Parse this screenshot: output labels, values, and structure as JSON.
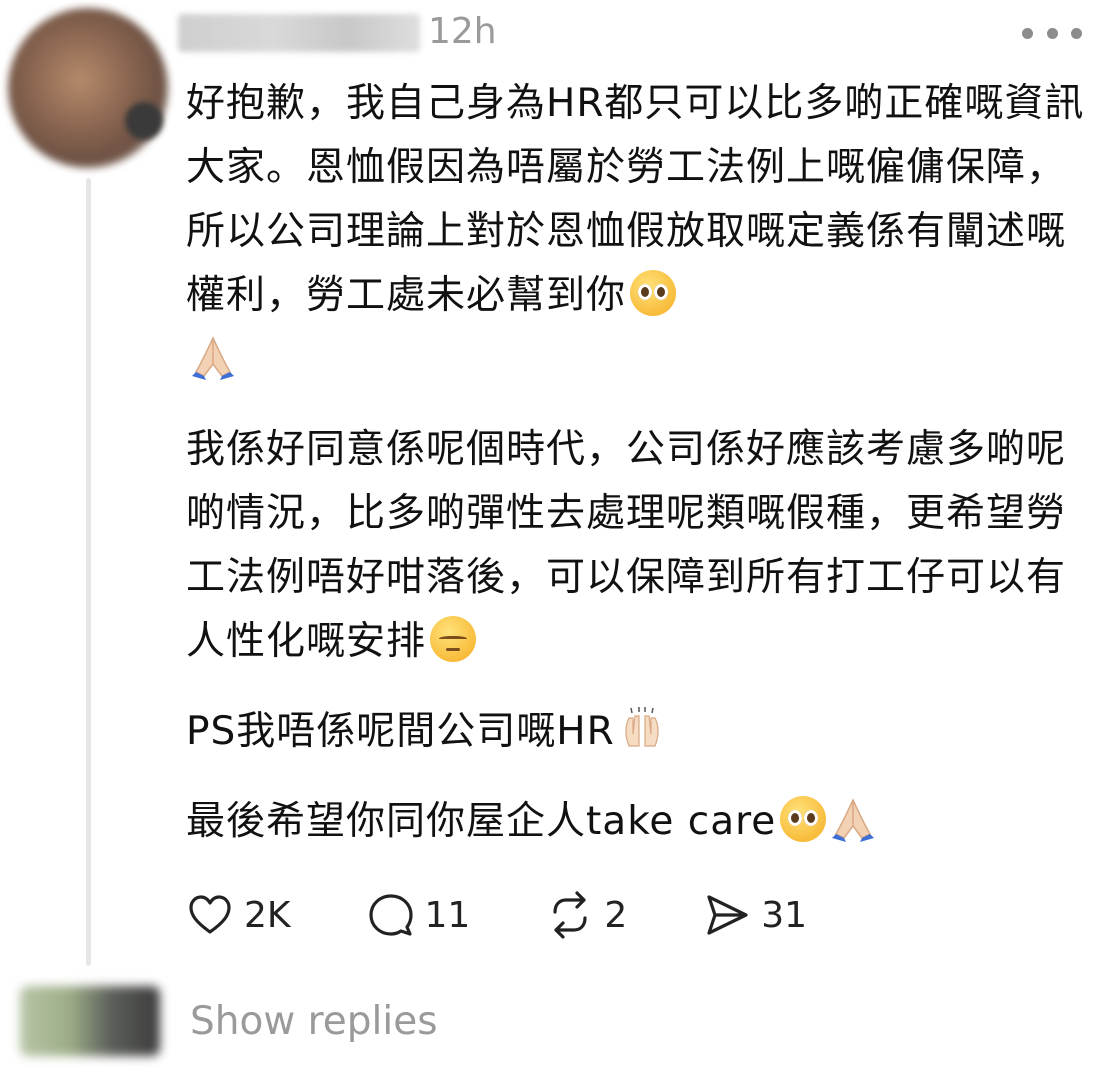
{
  "post": {
    "timestamp": "12h",
    "paragraphs": [
      "好抱歉，我自己身為HR都只可以比多啲正確嘅資訊大家。恩恤假因為唔屬於勞工法例上嘅僱傭保障，所以公司理論上對於恩恤假放取嘅定義係有闡述嘅權利，勞工處未必幫到你",
      "我係好同意係呢個時代，公司係好應該考慮多啲呢啲情況，比多啲彈性去處理呢類嘅假種，更希望勞工法例唔好咁落後，可以保障到所有打工仔可以有人性化嘅安排",
      "PS我唔係呢間公司嘅HR",
      "最後希望你同你屋企人take care"
    ]
  },
  "actions": {
    "likes": "2K",
    "comments": "11",
    "reposts": "2",
    "shares": "31"
  },
  "replies": {
    "label": "Show replies"
  },
  "icons": {
    "more": "more-horizontal-icon",
    "like": "heart-icon",
    "comment": "comment-bubble-icon",
    "repost": "repost-icon",
    "share": "send-icon"
  },
  "colors": {
    "text": "#111111",
    "muted": "#9a9a9a",
    "thread_line": "#e6e6e6"
  }
}
